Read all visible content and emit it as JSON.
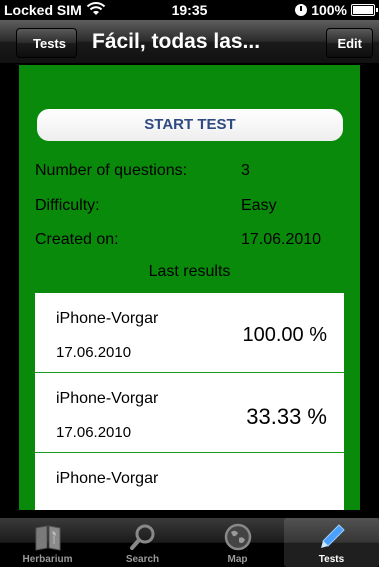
{
  "status_bar": {
    "carrier": "Locked SIM",
    "time": "19:35",
    "battery": "100%"
  },
  "nav_bar": {
    "back_label": "Tests",
    "title": "Fácil, todas las...",
    "edit_label": "Edit"
  },
  "content": {
    "start_label": "START TEST",
    "info": [
      {
        "label": "Number of questions:",
        "value": "3"
      },
      {
        "label": "Difficulty:",
        "value": "Easy"
      },
      {
        "label": "Created on:",
        "value": "17.06.2010"
      }
    ],
    "last_results_title": "Last results",
    "results": [
      {
        "name": "iPhone-Vorgar",
        "date": "17.06.2010",
        "score": "100.00 %"
      },
      {
        "name": "iPhone-Vorgar",
        "date": "17.06.2010",
        "score": "33.33 %"
      },
      {
        "name": "iPhone-Vorgar",
        "date": "",
        "score": ""
      }
    ]
  },
  "tab_bar": {
    "tabs": [
      {
        "label": "Herbarium",
        "icon": "book-icon"
      },
      {
        "label": "Search",
        "icon": "search-icon"
      },
      {
        "label": "Map",
        "icon": "globe-icon"
      },
      {
        "label": "Tests",
        "icon": "pencil-icon",
        "active": true
      }
    ]
  }
}
